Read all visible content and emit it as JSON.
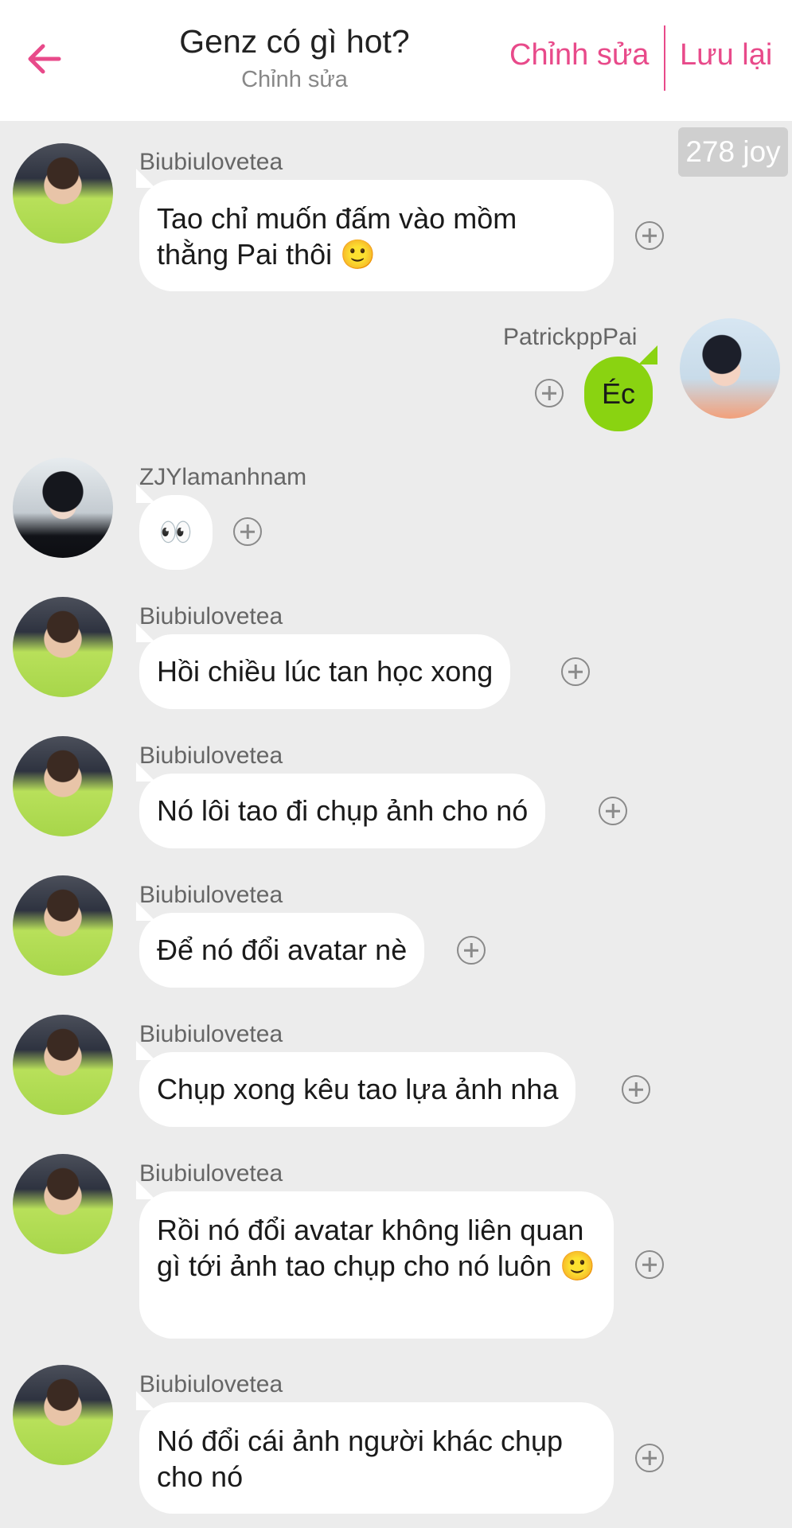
{
  "header": {
    "title": "Genz có gì hot?",
    "subtitle": "Chỉnh sửa",
    "edit_label": "Chỉnh sửa",
    "save_label": "Lưu lại",
    "accent_color": "#e84a8a"
  },
  "joy_badge": "278 joy",
  "messages": [
    {
      "sender": "Biubiulovetea",
      "text": "Tao chỉ muốn đấm vào mồm thằng Pai thôi 🙂",
      "side": "left"
    },
    {
      "sender": "PatrickppPai",
      "text": "Éc",
      "side": "right"
    },
    {
      "sender": "ZJYlamanhnam",
      "text": "👀",
      "side": "left"
    },
    {
      "sender": "Biubiulovetea",
      "text": "Hồi chiều lúc tan học xong",
      "side": "left"
    },
    {
      "sender": "Biubiulovetea",
      "text": "Nó lôi tao đi chụp ảnh cho nó",
      "side": "left"
    },
    {
      "sender": "Biubiulovetea",
      "text": "Để nó đổi avatar nè",
      "side": "left"
    },
    {
      "sender": "Biubiulovetea",
      "text": "Chụp xong kêu tao lựa ảnh nha",
      "side": "left"
    },
    {
      "sender": "Biubiulovetea",
      "text": "Rồi nó đổi avatar không liên quan gì tới ảnh tao chụp cho nó luôn 🙂",
      "side": "left"
    },
    {
      "sender": "Biubiulovetea",
      "text": "Nó đổi cái ảnh người khác chụp cho nó",
      "side": "left"
    }
  ],
  "icons": {
    "back": "arrow-left-icon",
    "add_reaction": "plus-circle-icon"
  },
  "colors": {
    "background": "#ececec",
    "my_bubble": "#8ad311",
    "other_bubble": "#ffffff"
  }
}
